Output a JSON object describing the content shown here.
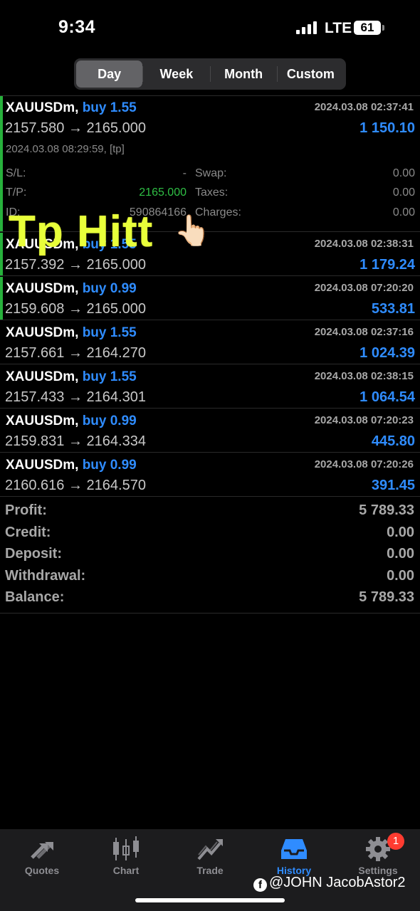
{
  "status_bar": {
    "time": "9:34",
    "network": "LTE",
    "battery": "61"
  },
  "period_tabs": [
    "Day",
    "Week",
    "Month",
    "Custom"
  ],
  "active_period": "Day",
  "deals": [
    {
      "symbol": "XAUUSDm,",
      "side": "buy 1.55",
      "time": "2024.03.08 02:37:41",
      "prices": "2157.580 → 2165.000",
      "profit": "1 150.10"
    },
    {
      "symbol": "XAUUSDm,",
      "side": "buy 1.55",
      "time": "2024.03.08 02:38:31",
      "prices": "2157.392 → 2165.000",
      "profit": "1 179.24"
    },
    {
      "symbol": "XAUUSDm,",
      "side": "buy 0.99",
      "time": "2024.03.08 07:20:20",
      "prices": "2159.608 → 2165.000",
      "profit": "533.81"
    },
    {
      "symbol": "XAUUSDm,",
      "side": "buy 1.55",
      "time": "2024.03.08 02:37:16",
      "prices": "2157.661 → 2164.270",
      "profit": "1 024.39"
    },
    {
      "symbol": "XAUUSDm,",
      "side": "buy 1.55",
      "time": "2024.03.08 02:38:15",
      "prices": "2157.433 → 2164.301",
      "profit": "1 064.54"
    },
    {
      "symbol": "XAUUSDm,",
      "side": "buy 0.99",
      "time": "2024.03.08 07:20:23",
      "prices": "2159.831 → 2164.334",
      "profit": "445.80"
    },
    {
      "symbol": "XAUUSDm,",
      "side": "buy 0.99",
      "time": "2024.03.08 07:20:26",
      "prices": "2160.616 → 2164.570",
      "profit": "391.45"
    }
  ],
  "expanded_details": {
    "close_info": "2024.03.08 08:29:59, [tp]",
    "sl_label": "S/L:",
    "sl_value": "-",
    "tp_label": "T/P:",
    "tp_value": "2165.000",
    "id_label": "ID:",
    "id_value": "590864166",
    "swap_label": "Swap:",
    "swap_value": "0.00",
    "taxes_label": "Taxes:",
    "taxes_value": "0.00",
    "charges_label": "Charges:",
    "charges_value": "0.00"
  },
  "overlay": {
    "text": "Tp Hitt",
    "emoji": "👆🏻"
  },
  "summary": [
    {
      "label": "Profit:",
      "value": "5 789.33"
    },
    {
      "label": "Credit:",
      "value": "0.00"
    },
    {
      "label": "Deposit:",
      "value": "0.00"
    },
    {
      "label": "Withdrawal:",
      "value": "0.00"
    },
    {
      "label": "Balance:",
      "value": "5 789.33"
    }
  ],
  "tabbar": {
    "items": [
      {
        "label": "Quotes",
        "icon": "quotes-arrows-icon"
      },
      {
        "label": "Chart",
        "icon": "candlestick-chart-icon"
      },
      {
        "label": "Trade",
        "icon": "trade-trend-icon"
      },
      {
        "label": "History",
        "icon": "history-tray-icon"
      },
      {
        "label": "Settings",
        "icon": "gear-icon"
      }
    ],
    "active": "History",
    "settings_badge": "1"
  },
  "watermark": {
    "fb_glyph": "f",
    "text": "@JOHN JacobAstor2"
  },
  "colors": {
    "accent": "#2f8cff",
    "green": "#27b13c",
    "yellow": "#e8ff3a",
    "badge": "#ff3b30"
  }
}
